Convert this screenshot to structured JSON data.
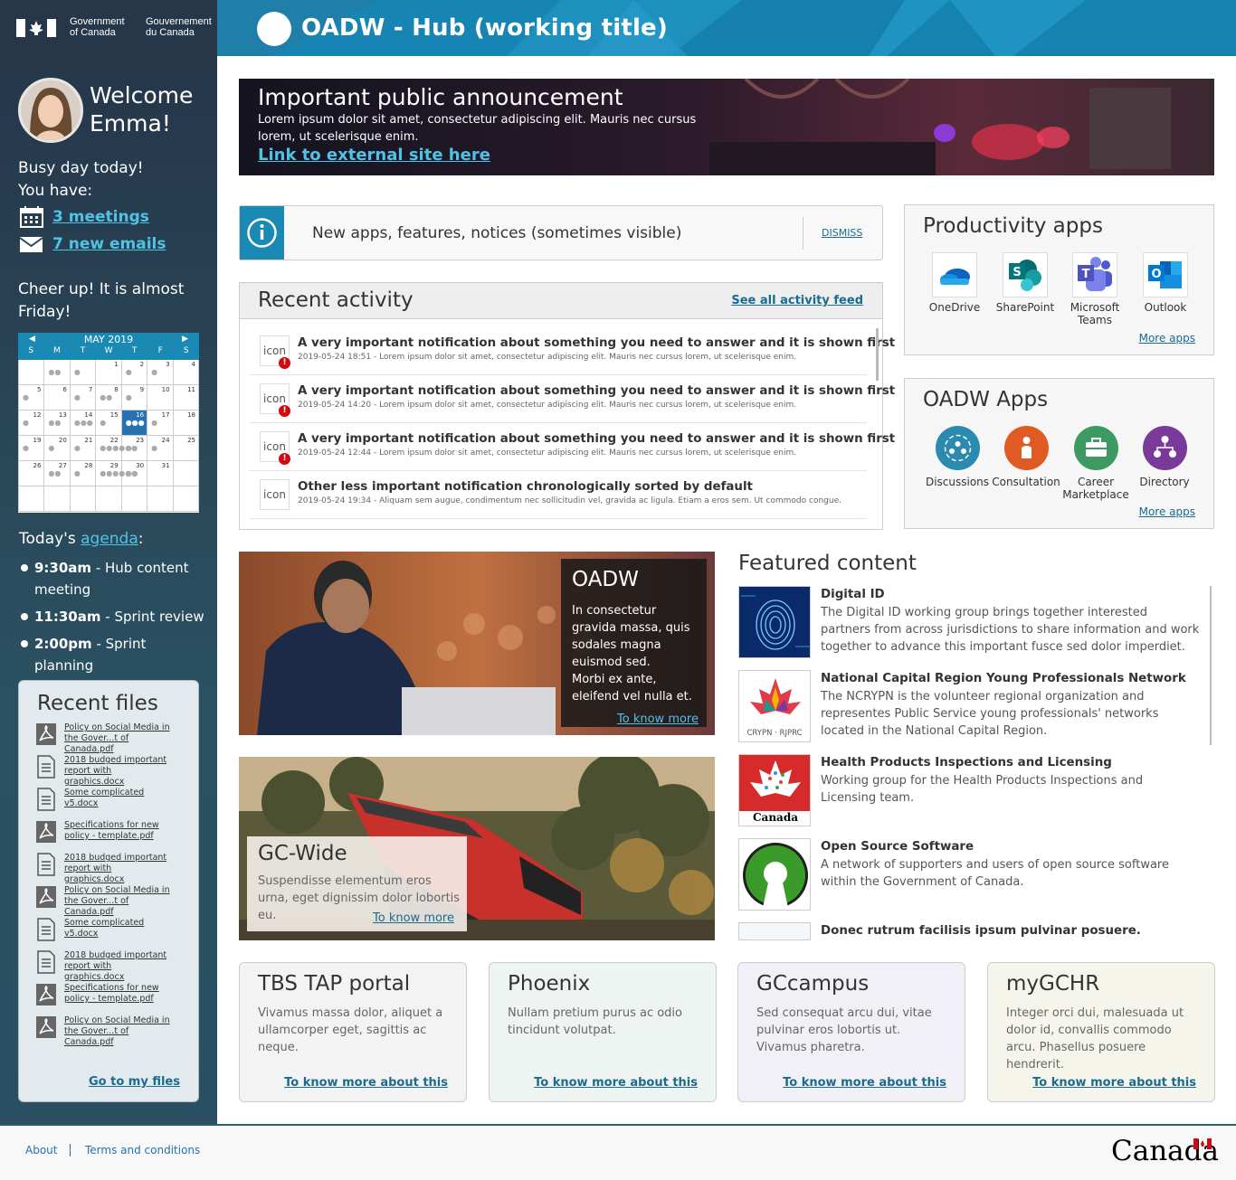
{
  "header": {
    "gov_en": [
      "Government",
      "of Canada"
    ],
    "gov_fr": [
      "Gouvernement",
      "du Canada"
    ],
    "app_title": "OADW - Hub (working title)"
  },
  "sidebar": {
    "welcome": [
      "Welcome",
      "Emma!"
    ],
    "busy": [
      "Busy day today!",
      "You have:"
    ],
    "meetings_link": "3 meetings",
    "emails_link": "7 new emails",
    "cheer": "Cheer up! It is almost Friday!",
    "calendar": {
      "month": "MAY 2019",
      "days": [
        "S",
        "M",
        "T",
        "W",
        "T",
        "F",
        "S"
      ],
      "cells": [
        {
          "n": "",
          "d": ""
        },
        {
          "n": "",
          "d": "●●"
        },
        {
          "n": "",
          "d": "●"
        },
        {
          "n": "1",
          "d": ""
        },
        {
          "n": "2",
          "d": "●"
        },
        {
          "n": "3",
          "d": "●"
        },
        {
          "n": "4",
          "d": ""
        },
        {
          "n": "5",
          "d": "●"
        },
        {
          "n": "6",
          "d": ""
        },
        {
          "n": "7",
          "d": "●"
        },
        {
          "n": "8",
          "d": "●●"
        },
        {
          "n": "9",
          "d": "●"
        },
        {
          "n": "10",
          "d": ""
        },
        {
          "n": "11",
          "d": ""
        },
        {
          "n": "12",
          "d": "●"
        },
        {
          "n": "13",
          "d": "●●"
        },
        {
          "n": "14",
          "d": "●●●"
        },
        {
          "n": "15",
          "d": "●"
        },
        {
          "n": "16",
          "d": "●●●"
        },
        {
          "n": "17",
          "d": "●"
        },
        {
          "n": "18",
          "d": ""
        },
        {
          "n": "19",
          "d": "●"
        },
        {
          "n": "20",
          "d": "●"
        },
        {
          "n": "21",
          "d": "●"
        },
        {
          "n": "22",
          "d": "●●●●●●"
        },
        {
          "n": "23",
          "d": "●"
        },
        {
          "n": "24",
          "d": "●"
        },
        {
          "n": "25",
          "d": ""
        },
        {
          "n": "26",
          "d": ""
        },
        {
          "n": "27",
          "d": "●●"
        },
        {
          "n": "28",
          "d": "●"
        },
        {
          "n": "29",
          "d": "●●●●●●"
        },
        {
          "n": "30",
          "d": "●●"
        },
        {
          "n": "31",
          "d": ""
        },
        {
          "n": "",
          "d": ""
        },
        {
          "n": "",
          "d": ""
        },
        {
          "n": "",
          "d": ""
        },
        {
          "n": "",
          "d": ""
        },
        {
          "n": "",
          "d": ""
        },
        {
          "n": "",
          "d": ""
        },
        {
          "n": "",
          "d": ""
        },
        {
          "n": "",
          "d": ""
        }
      ],
      "today": "16"
    },
    "agenda_prefix": "Today's ",
    "agenda_link": "agenda",
    "agenda_suffix": ":",
    "agenda": [
      {
        "time": "9:30am",
        "text": " - Hub content meeting"
      },
      {
        "time": "11:30am",
        "text": " - Sprint review"
      },
      {
        "time": "2:00pm",
        "text": " - Sprint planning"
      }
    ],
    "recent_files_title": "Recent files",
    "files": [
      {
        "type": "pdf",
        "name": "Policy on Social Media in the Gover...t of Canada.pdf"
      },
      {
        "type": "doc",
        "name": "2018 budged important report with graphics.docx"
      },
      {
        "type": "doc",
        "name": "Some complicated v5.docx"
      },
      {
        "type": "pdf",
        "name": "Specifications for new policy - template.pdf"
      },
      {
        "type": "doc",
        "name": "2018 budged important report with graphics.docx"
      },
      {
        "type": "pdf",
        "name": "Policy on Social Media in the Gover...t of Canada.pdf"
      },
      {
        "type": "doc",
        "name": "Some complicated v5.docx"
      },
      {
        "type": "doc",
        "name": "2018 budged important report with graphics.docx"
      },
      {
        "type": "pdf",
        "name": "Specifications for new policy - template.pdf"
      },
      {
        "type": "pdf",
        "name": "Policy on Social Media in the Gover...t of Canada.pdf"
      }
    ],
    "files_link": "Go to my files"
  },
  "announcement": {
    "title": "Important public announcement",
    "text": "Lorem ipsum dolor sit amet, consectetur adipiscing elit. Mauris nec cursus lorem, ut scelerisque enim.",
    "link": "Link to external site here"
  },
  "notice": {
    "text": "New apps, features, notices (sometimes visible)",
    "dismiss": "DISMISS"
  },
  "activity": {
    "title": "Recent activity",
    "link": "See all activity feed",
    "items": [
      {
        "icon": "icon",
        "alert": true,
        "title": "A very important notification about something you need to answer and it is shown first",
        "sub": "2019-05-24 18:51 - Lorem ipsum dolor sit amet, consectetur adipiscing elit. Mauris nec cursus lorem, ut scelerisque enim."
      },
      {
        "icon": "icon",
        "alert": true,
        "title": "A very important notification about something you need to answer and it is shown first",
        "sub": "2019-05-24 14:20 - Lorem ipsum dolor sit amet, consectetur adipiscing elit. Mauris nec cursus lorem, ut scelerisque enim."
      },
      {
        "icon": "icon",
        "alert": true,
        "title": "A very important notification about something you need to answer and it is shown first",
        "sub": "2019-05-24 12:44 - Lorem ipsum dolor sit amet, consectetur adipiscing elit. Mauris nec cursus lorem, ut scelerisque enim."
      },
      {
        "icon": "icon",
        "alert": false,
        "title": "Other less important notification chronologically sorted by default",
        "sub": "2019-05-24 19:34 - Aliquam sem augue, condimentum nec sollicitudin vel, gravida ac ligula. Etiam a eros sem. Ut commodo congue."
      }
    ]
  },
  "productivity": {
    "title": "Productivity apps",
    "apps": [
      "OneDrive",
      "SharePoint",
      "Microsoft Teams",
      "Outlook"
    ],
    "more": "More apps"
  },
  "oadw_apps": {
    "title": "OADW Apps",
    "apps": [
      "Discussions",
      "Consultation",
      "Career Marketplace",
      "Directory"
    ],
    "colors": [
      "#2a8ab0",
      "#e05a24",
      "#3e9a63",
      "#7a3a9a"
    ],
    "more": "More apps"
  },
  "card_oadw": {
    "title": "OADW",
    "text1": "In consectetur gravida massa, quis sodales magna euismod sed.",
    "text2": "Morbi ex ante, eleifend vel nulla et.",
    "link": "To know more"
  },
  "card_gc": {
    "title": "GC-Wide",
    "text": "Suspendisse elementum eros urna, eget dignissim dolor lobortis eu.",
    "link": "To know more"
  },
  "featured": {
    "title": "Featured content",
    "items": [
      {
        "title": "Digital ID",
        "desc": "The Digital ID working group brings together interested partners from across jurisdictions  to share information and work together to advance this important fusce sed dolor imperdiet."
      },
      {
        "title": "National Capital Region Young Professionals Network",
        "desc": "The NCRYPN is the volunteer regional organization and representes Public Service young professionals' networks located in the National Capital Region."
      },
      {
        "title": "Health Products Inspections and Licensing",
        "desc": "Working group for the Health Products Inspections and Licensing team."
      },
      {
        "title": "Open Source Software",
        "desc": "A network of supporters and users of open source software within the Government of Canada."
      },
      {
        "title": "Donec rutrum facilisis ipsum pulvinar posuere.",
        "desc": ""
      }
    ],
    "logo_texts": [
      "CRYPN · RJPRC",
      "Canada"
    ]
  },
  "bottom_cards": [
    {
      "title": "TBS TAP portal",
      "text": "Vivamus massa dolor, aliquet a ullamcorper eget, sagittis ac neque.",
      "link": "To know more about this",
      "bg": "#f3f3f3"
    },
    {
      "title": "Phoenix",
      "text": "Nullam pretium purus ac odio tincidunt volutpat.",
      "link": "To know more about this",
      "bg": "#eef4f1"
    },
    {
      "title": "GCcampus",
      "text": "Sed consequat arcu dui, vitae pulvinar eros lobortis ut. Vivamus pharetra.",
      "link": "To know more about this",
      "bg": "#f1f0f6"
    },
    {
      "title": "myGCHR",
      "text": "Integer orci dui, malesuada ut dolor id, convallis commodo arcu. Phasellus posuere hendrerit.",
      "link": "To know more about this",
      "bg": "#f6f5ec"
    }
  ],
  "footer": {
    "about": "About",
    "terms": "Terms and conditions",
    "wordmark": "Canada"
  }
}
